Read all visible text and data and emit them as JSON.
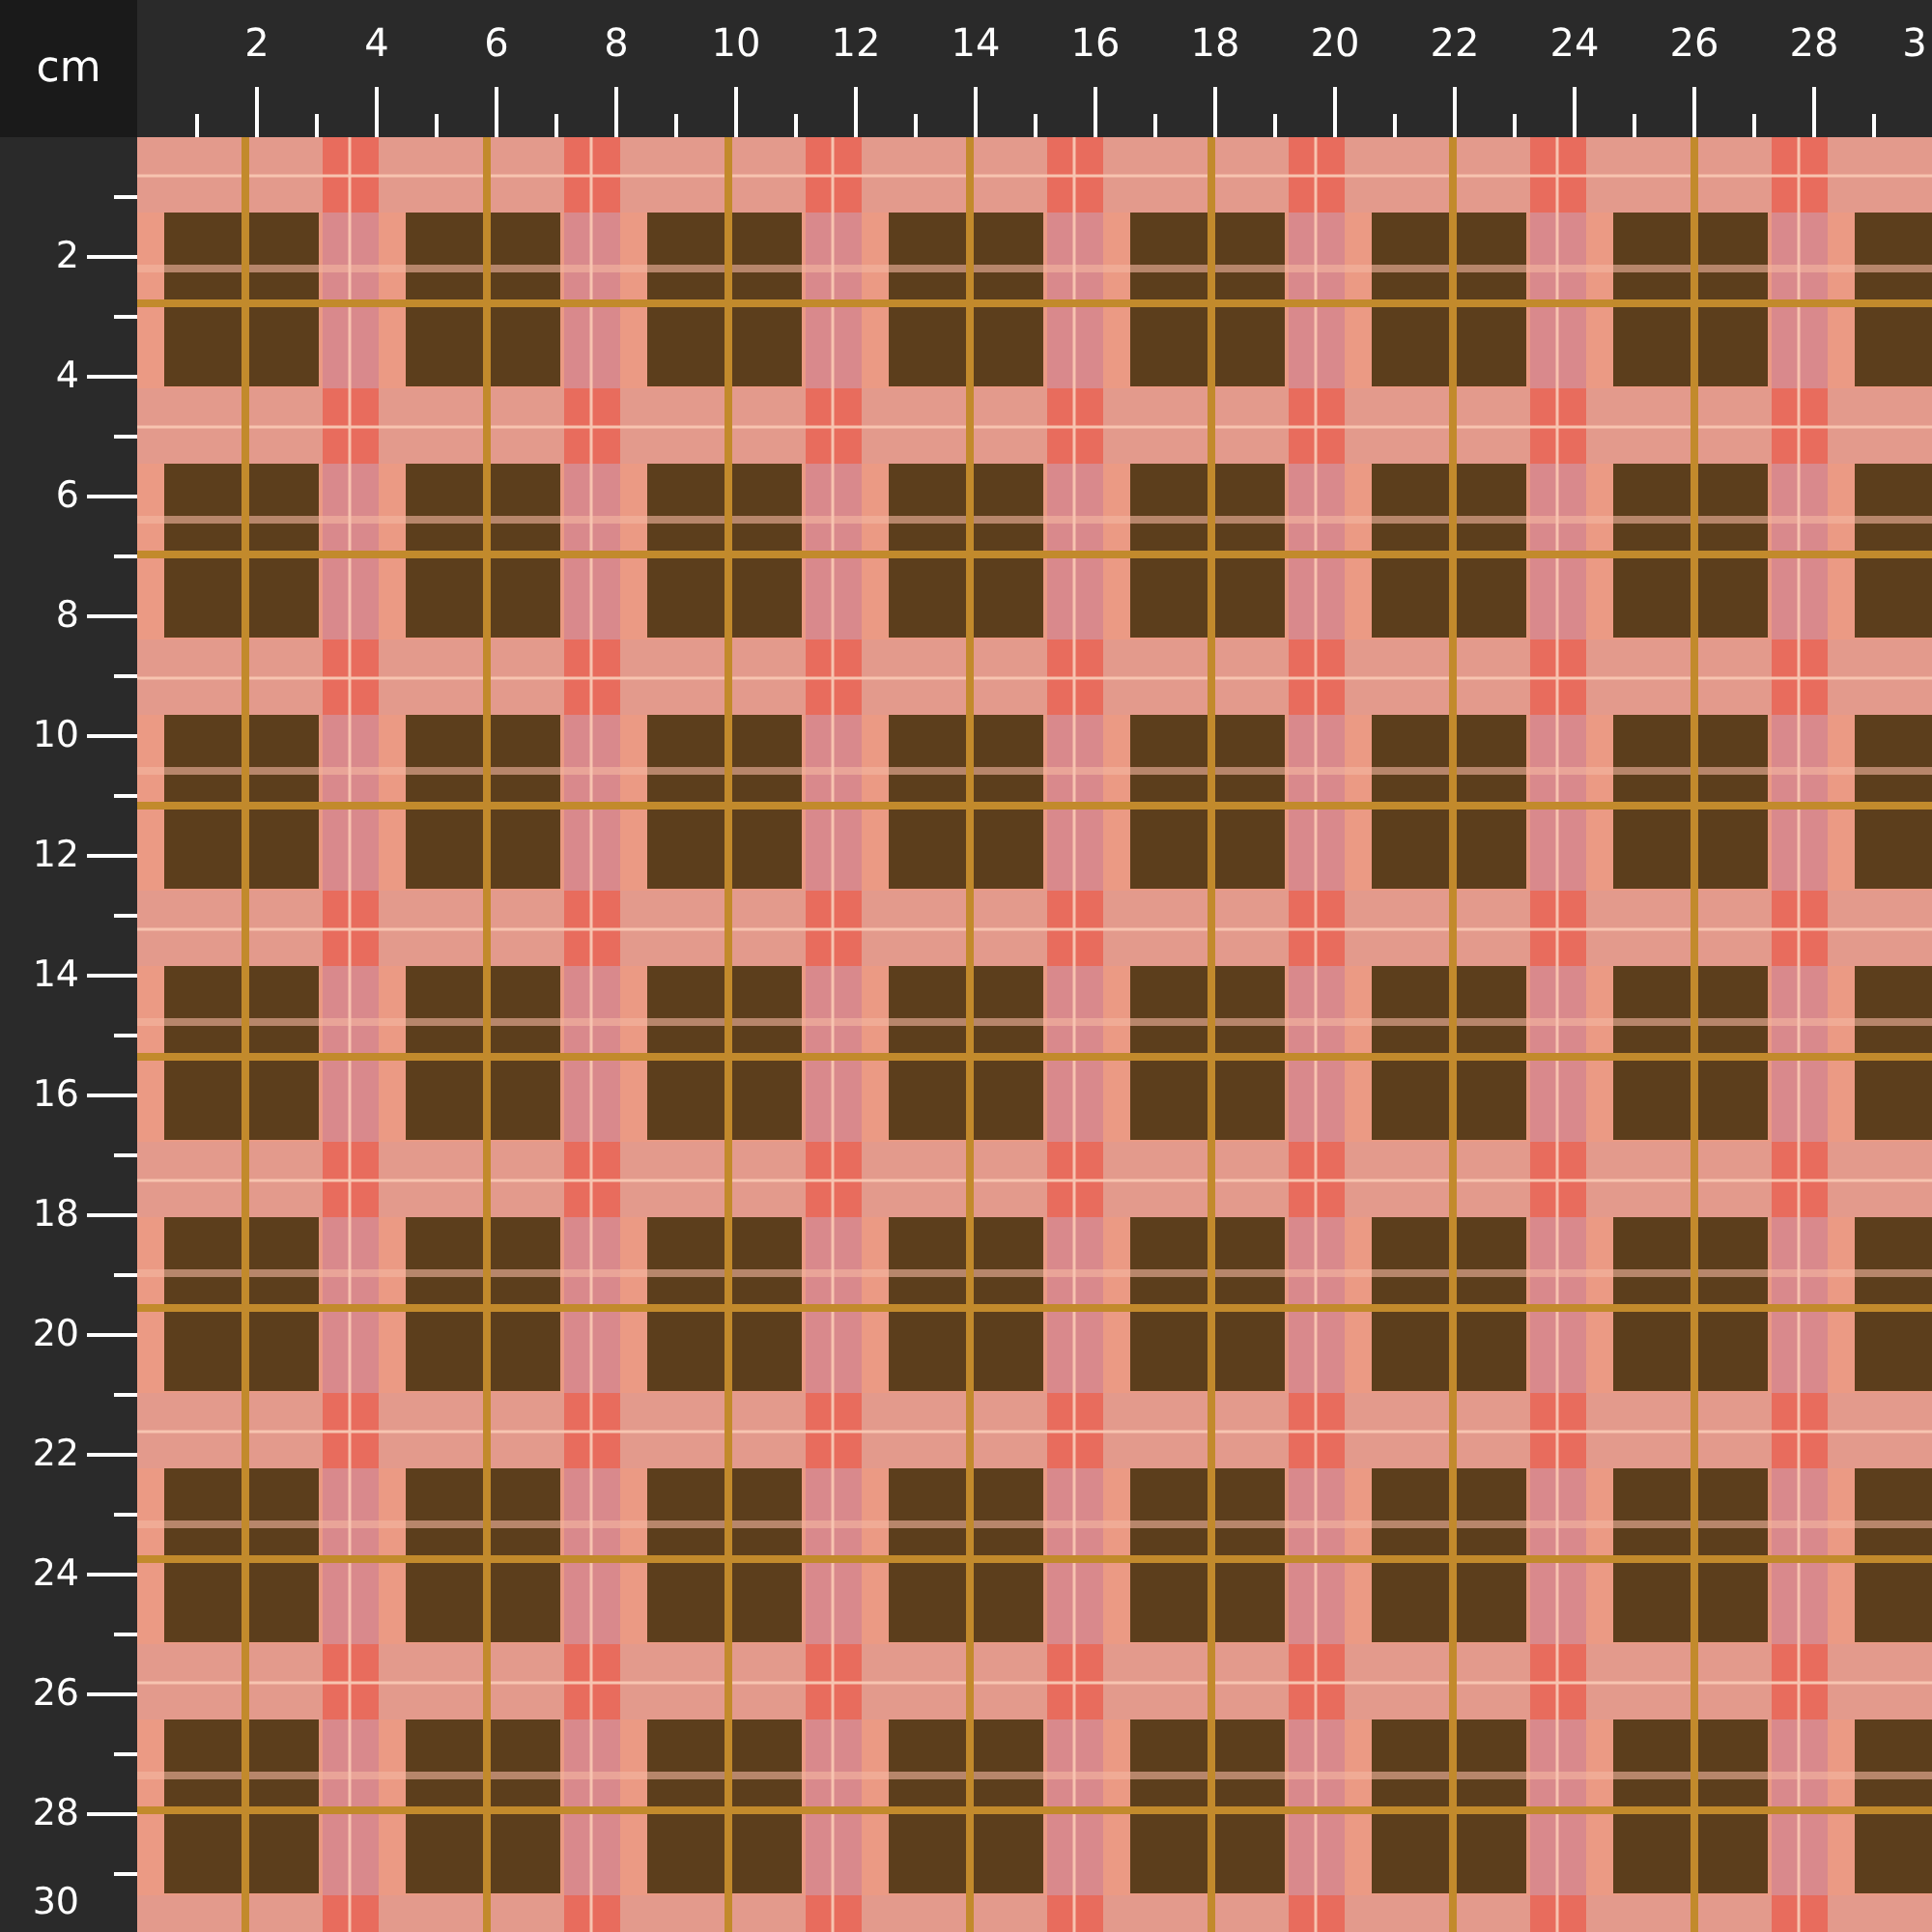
{
  "ruler_unit": "cm",
  "top_ruler": {
    "labels": [
      "2",
      "4",
      "6",
      "8",
      "10",
      "12",
      "14",
      "16",
      "18",
      "20",
      "22",
      "24",
      "26",
      "28",
      "3"
    ]
  },
  "left_ruler": {
    "labels": [
      "2",
      "4",
      "6",
      "8",
      "10",
      "12",
      "14",
      "16",
      "18",
      "20",
      "22",
      "24",
      "26",
      "28",
      "30"
    ]
  }
}
